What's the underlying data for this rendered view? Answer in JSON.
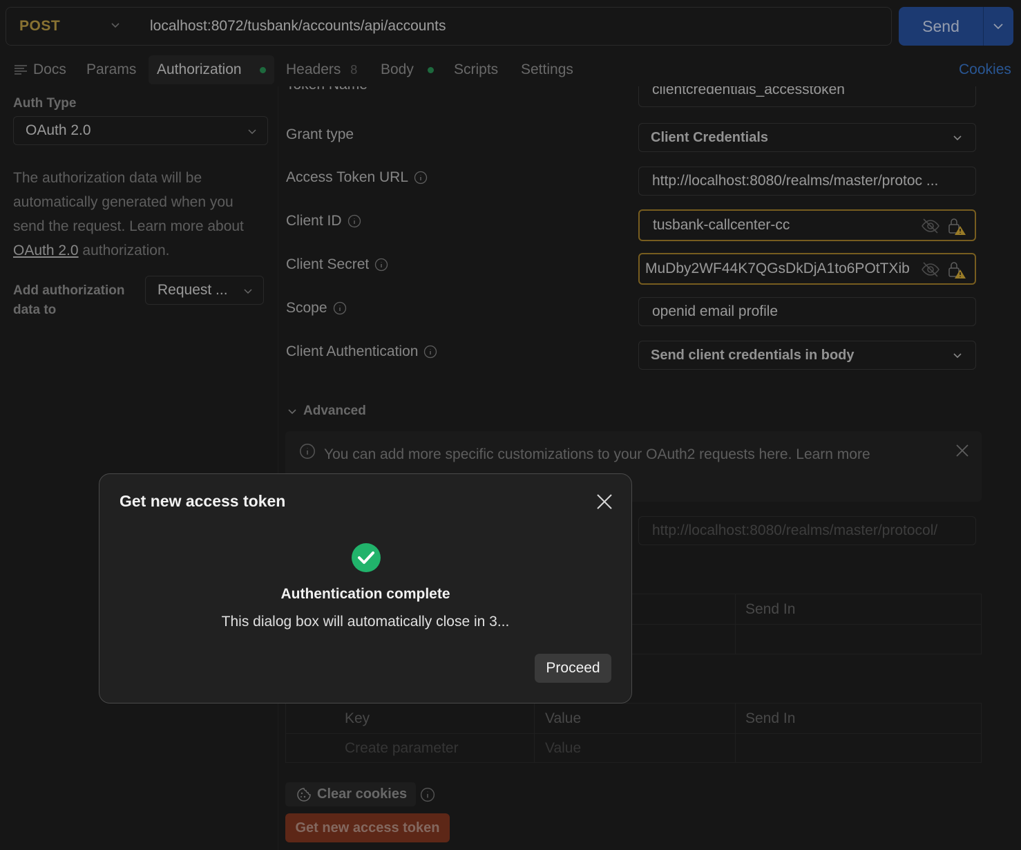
{
  "request": {
    "method": "POST",
    "url": "localhost:8072/tusbank/accounts/api/accounts",
    "send_label": "Send"
  },
  "tabs": [
    {
      "label": "Docs"
    },
    {
      "label": "Params"
    },
    {
      "label": "Authorization",
      "active": true,
      "dot": true
    },
    {
      "label": "Headers",
      "count": "8"
    },
    {
      "label": "Body",
      "dot": true
    },
    {
      "label": "Scripts"
    },
    {
      "label": "Settings"
    }
  ],
  "cookies_label": "Cookies",
  "left_panel": {
    "auth_type_label": "Auth Type",
    "auth_type_value": "OAuth 2.0",
    "help_text_1": "The authorization data will be automatically generated when you send the request. Learn more about",
    "help_link": "OAuth 2.0",
    "help_text_2": "authorization.",
    "add_auth_label": "Add authorization data to",
    "add_auth_value": "Request ..."
  },
  "form": {
    "token_name_label": "Token Name",
    "token_name_value": "clientcredentials_accesstoken",
    "grant_type_label": "Grant type",
    "grant_type_value": "Client Credentials",
    "access_token_url_label": "Access Token URL",
    "access_token_url_value": "http://localhost:8080/realms/master/protoc ...",
    "client_id_label": "Client ID",
    "client_id_value": "tusbank-callcenter-cc",
    "client_secret_label": "Client Secret",
    "client_secret_value": "MuDby2WF44K7QGsDkDjA1to6POtTXib",
    "scope_label": "Scope",
    "scope_value": "openid email profile",
    "client_auth_label": "Client Authentication",
    "client_auth_value": "Send client credentials in body"
  },
  "advanced": {
    "label": "Advanced",
    "banner_text": "You can add more specific customizations to your OAuth2 requests here. Learn more",
    "refresh_url_placeholder": "http://localhost:8080/realms/master/protocol/"
  },
  "table1": {
    "send_in_header": "Send In"
  },
  "table2": {
    "key_header": "Key",
    "value_header": "Value",
    "send_in_header": "Send In",
    "key_placeholder": "Create parameter",
    "value_placeholder": "Value"
  },
  "buttons": {
    "clear_cookies": "Clear cookies",
    "get_token": "Get new access token"
  },
  "modal": {
    "title": "Get new access token",
    "heading": "Authentication complete",
    "message": "This dialog box will automatically close in 3...",
    "proceed": "Proceed"
  },
  "colors": {
    "method": "#c9a94a",
    "send_button": "#2a56a8",
    "link": "#3d7fd9",
    "success": "#21b36b",
    "warning_border": "#b08a2e",
    "get_token_button": "#8a3a22"
  }
}
